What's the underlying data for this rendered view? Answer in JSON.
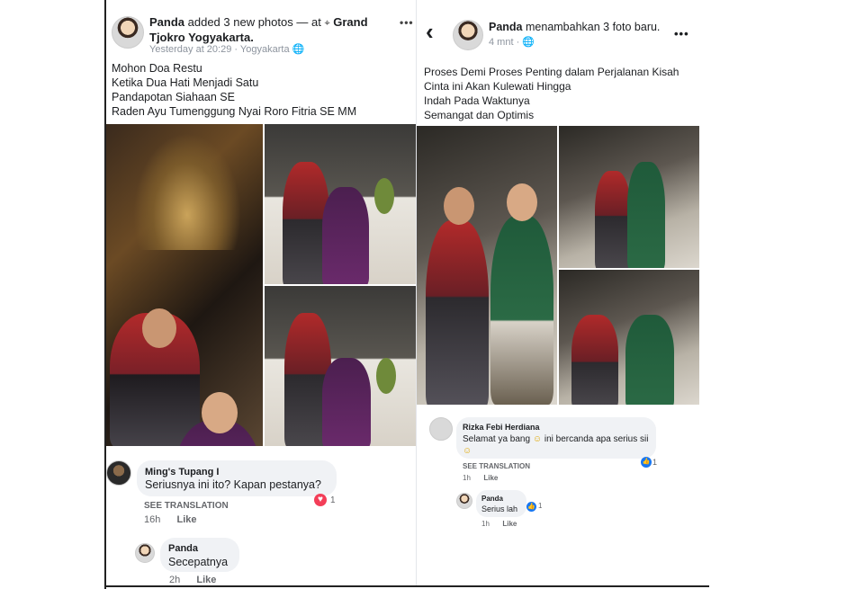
{
  "left_post": {
    "author": "Panda",
    "action": "added 3 new photos — at",
    "place_icon": "location-pin-icon",
    "place": "Grand Tjokro Yogyakarta.",
    "time": "Yesterday at 20:29",
    "time_sep": " · ",
    "location": "Yogyakarta",
    "audience_icon": "globe-icon",
    "more_icon": "more-dots-icon",
    "more_glyph": "•••",
    "text": [
      "Mohon Doa Restu",
      "Ketika Dua Hati Menjadi Satu",
      "Pandapotan Siahaan SE",
      "Raden Ayu Tumenggung Nyai Roro Fitria SE MM"
    ],
    "comment1": {
      "author": "Ming's Tupang I",
      "text": "Seriusnya ini ito?  Kapan pestanya?",
      "see_translation": "SEE TRANSLATION",
      "time": "16h",
      "like": "Like",
      "reaction_icon": "love-reaction-icon",
      "reaction_glyph": "♥",
      "reaction_count": "1"
    },
    "reply1": {
      "author": "Panda",
      "text": "Secepatnya",
      "time": "2h",
      "like": "Like"
    }
  },
  "right_post": {
    "back_glyph": "‹",
    "author": "Panda",
    "action": "menambahkan 3 foto baru.",
    "time": "4 mnt",
    "time_sep": " · ",
    "more_glyph": "•••",
    "text": [
      "Proses Demi Proses Penting dalam Perjalanan Kisah",
      "Cinta ini Akan Kulewati Hingga",
      "Indah Pada Waktunya",
      "Semangat dan Optimis"
    ],
    "comment1": {
      "author": "Rizka Febi Herdiana",
      "text_a": "Selamat ya bang",
      "emoji1": "☺",
      "text_b": "ini bercanda apa serius sii",
      "emoji2": "☺",
      "see_translation": "SEE TRANSLATION",
      "time": "1h",
      "like": "Like",
      "reaction_icon": "like-reaction-icon",
      "reaction_glyph": "👍",
      "reaction_count": "1"
    },
    "reply1": {
      "author": "Panda",
      "text": "Serius lah",
      "time": "1h",
      "like": "Like",
      "reaction_glyph": "👍",
      "reaction_count": "1"
    }
  }
}
